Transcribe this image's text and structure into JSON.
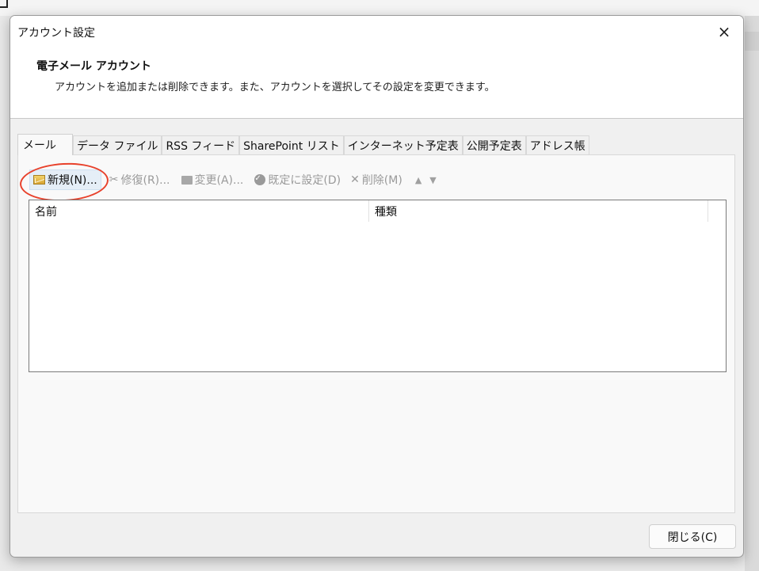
{
  "dialog": {
    "title": "アカウント設定",
    "close_icon": "×"
  },
  "header": {
    "title": "電子メール アカウント",
    "description": "アカウントを追加または削除できます。また、アカウントを選択してその設定を変更できます。"
  },
  "tabs": [
    {
      "label": "メール",
      "active": true
    },
    {
      "label": "データ ファイル",
      "active": false
    },
    {
      "label": "RSS フィード",
      "active": false
    },
    {
      "label": "SharePoint リスト",
      "active": false
    },
    {
      "label": "インターネット予定表",
      "active": false
    },
    {
      "label": "公開予定表",
      "active": false
    },
    {
      "label": "アドレス帳",
      "active": false
    }
  ],
  "toolbar": {
    "new_label": "新規(N)...",
    "repair_label": "修復(R)...",
    "change_label": "変更(A)...",
    "default_label": "既定に設定(D)",
    "delete_label": "削除(M)",
    "up_icon": "arrow-up-icon",
    "down_icon": "arrow-down-icon",
    "new_icon": "new-account-envelope-icon",
    "repair_icon": "repair-tools-icon",
    "change_icon": "change-icon",
    "default_icon": "checkmark-circle-icon",
    "delete_icon": "delete-x-icon"
  },
  "list": {
    "columns": [
      "名前",
      "種類"
    ],
    "rows": []
  },
  "footer": {
    "close_label": "閉じる(C)"
  },
  "annotation": {
    "color": "#e8412b"
  }
}
